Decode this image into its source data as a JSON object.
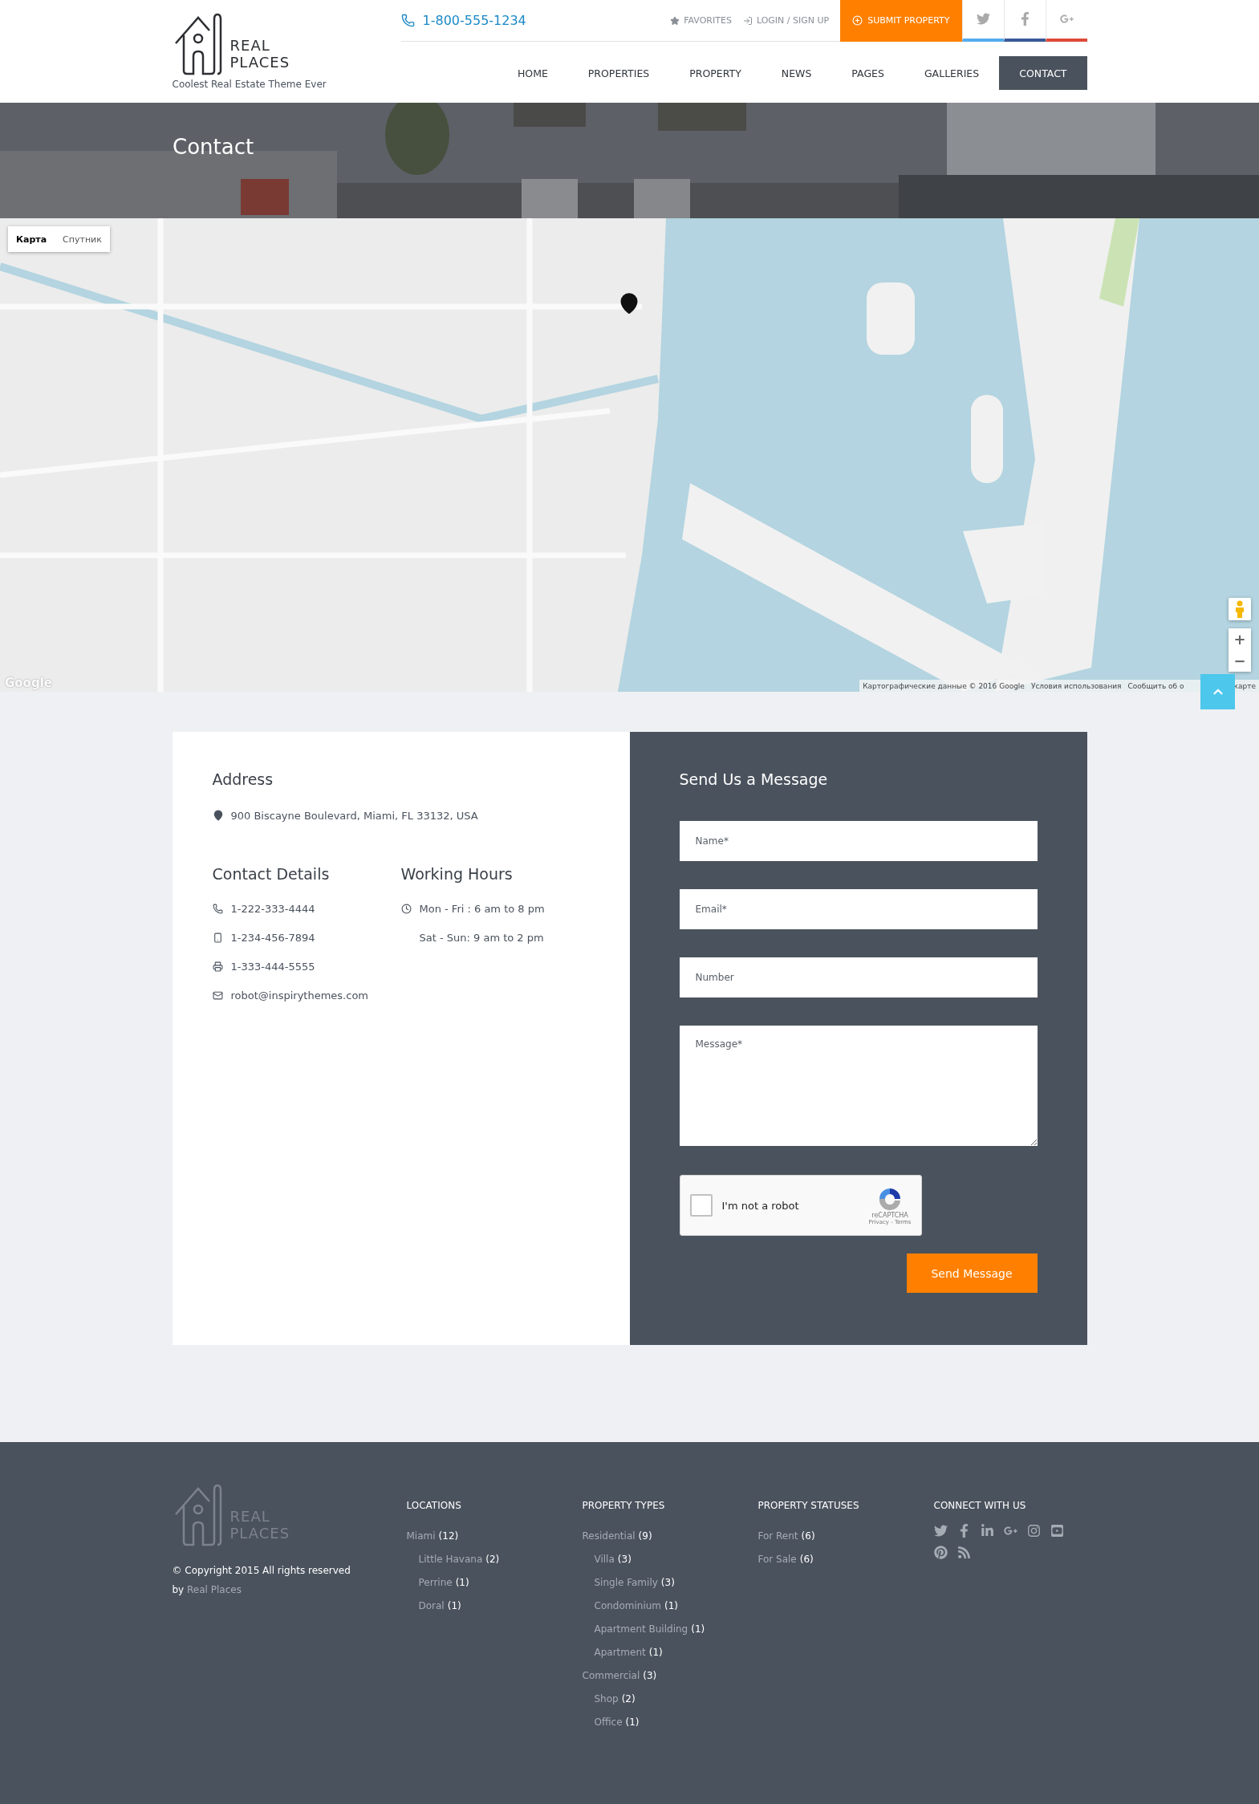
{
  "header": {
    "logo": {
      "line1": "REAL",
      "line2": "PLACES",
      "tagline": "Coolest Real Estate Theme Ever"
    },
    "phone": "1-800-555-1234",
    "top_links": [
      {
        "kind": "favorites",
        "label": "FAVORITES"
      },
      {
        "kind": "login",
        "label": "LOGIN / SIGN UP"
      }
    ],
    "submit": "SUBMIT PROPERTY",
    "social": [
      {
        "kind": "twitter",
        "color": "#55acee"
      },
      {
        "kind": "facebook",
        "color": "#3b5998"
      },
      {
        "kind": "google-plus",
        "color": "#dd4b39"
      }
    ],
    "nav": [
      {
        "label": "HOME",
        "selected": false
      },
      {
        "label": "PROPERTIES",
        "selected": false
      },
      {
        "label": "PROPERTY",
        "selected": false
      },
      {
        "label": "NEWS",
        "selected": false
      },
      {
        "label": "PAGES",
        "selected": false
      },
      {
        "label": "GALLERIES",
        "selected": false
      },
      {
        "label": "CONTACT",
        "selected": true
      }
    ]
  },
  "banner": {
    "title": "Contact",
    "kind": "picture"
  },
  "map": {
    "kind": "picture",
    "map_types": [
      {
        "label": "Карта",
        "selected": true
      },
      {
        "label": "Спутник",
        "selected": false
      }
    ],
    "zoom": [
      "+",
      "−"
    ],
    "google_logo": "Google",
    "attribution": [
      "Картографические данные © 2016 Google",
      "Условия использования",
      "Сообщить об о",
      "карте"
    ]
  },
  "contact": {
    "address": {
      "title": "Address",
      "text": "900 Biscayne Boulevard, Miami, FL 33132, USA"
    },
    "details": {
      "title": "Contact Details",
      "items": [
        {
          "kind": "phone",
          "text": "1-222-333-4444"
        },
        {
          "kind": "mobile",
          "text": "1-234-456-7894"
        },
        {
          "kind": "fax",
          "text": "1-333-444-5555"
        },
        {
          "kind": "email",
          "text": "robot@inspirythemes.com"
        }
      ]
    },
    "hours": {
      "title": "Working Hours",
      "items": [
        {
          "kind": "clock",
          "text": "Mon - Fri : 6 am to 8 pm"
        },
        {
          "kind": "plain",
          "text": "Sat - Sun: 9 am to 2 pm"
        }
      ]
    },
    "form": {
      "title": "Send Us a Message",
      "fields": [
        {
          "kind": "input",
          "placeholder": "Name*"
        },
        {
          "kind": "input",
          "placeholder": "Email*"
        },
        {
          "kind": "input",
          "placeholder": "Number"
        },
        {
          "kind": "textarea",
          "placeholder": "Message*"
        }
      ],
      "captcha": {
        "label": "I'm not a robot",
        "checked": false,
        "brand": "reCAPTCHA",
        "links": "Privacy - Terms"
      },
      "button": "Send Message"
    }
  },
  "footer": {
    "logo": {
      "line1": "REAL",
      "line2": "PLACES"
    },
    "copyright": "© Copyright 2015 All rights reserved",
    "by": "by",
    "by_link": "Real Places",
    "columns": [
      {
        "title": "LOCATIONS",
        "items": [
          {
            "name": "Miami",
            "count": "(12)",
            "children": [
              {
                "name": "Little Havana",
                "count": "(2)"
              },
              {
                "name": "Perrine",
                "count": "(1)"
              },
              {
                "name": "Doral",
                "count": "(1)"
              }
            ]
          }
        ]
      },
      {
        "title": "PROPERTY TYPES",
        "items": [
          {
            "name": "Residential",
            "count": "(9)",
            "children": [
              {
                "name": "Villa",
                "count": "(3)"
              },
              {
                "name": "Single Family",
                "count": "(3)"
              },
              {
                "name": "Condominium",
                "count": "(1)"
              },
              {
                "name": "Apartment Building",
                "count": "(1)"
              },
              {
                "name": "Apartment",
                "count": "(1)"
              }
            ]
          },
          {
            "name": "Commercial",
            "count": "(3)",
            "children": [
              {
                "name": "Shop",
                "count": "(2)"
              },
              {
                "name": "Office",
                "count": "(1)"
              }
            ]
          }
        ]
      },
      {
        "title": "PROPERTY STATUSES",
        "items": [
          {
            "name": "For Rent",
            "count": "(6)"
          },
          {
            "name": "For Sale",
            "count": "(6)"
          }
        ]
      }
    ],
    "connect": {
      "title": "CONNECT WITH US",
      "icons": [
        {
          "kind": "twitter"
        },
        {
          "kind": "facebook"
        },
        {
          "kind": "linkedin"
        },
        {
          "kind": "google-plus"
        },
        {
          "kind": "instagram"
        },
        {
          "kind": "youtube"
        },
        {
          "kind": "pinterest"
        },
        {
          "kind": "rss"
        }
      ]
    }
  }
}
